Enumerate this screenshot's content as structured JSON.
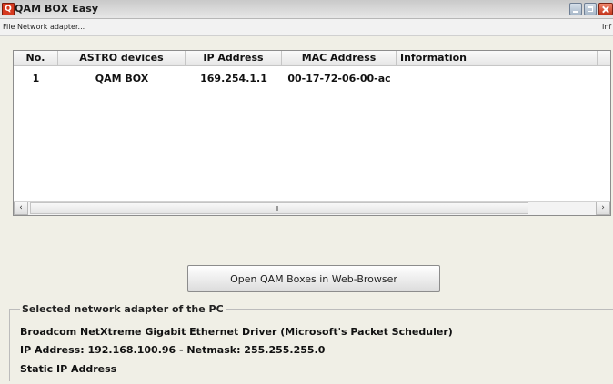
{
  "window": {
    "title": "QAM BOX Easy"
  },
  "menu": {
    "items": [
      "File",
      "Network adapter...",
      "Inf"
    ]
  },
  "table": {
    "headers": [
      "No.",
      "ASTRO devices",
      "IP Address",
      "MAC Address",
      "Information"
    ],
    "rows": [
      {
        "no": "1",
        "device": "QAM BOX",
        "ip": "169.254.1.1",
        "mac": "00-17-72-06-00-ac",
        "info": ""
      }
    ]
  },
  "buttons": {
    "open_web": "Open QAM Boxes in Web-Browser"
  },
  "adapter": {
    "group_title": "Selected network adapter of the PC",
    "driver": "Broadcom NetXtreme Gigabit Ethernet Driver (Microsoft's Packet Scheduler)",
    "address_line": "IP Address: 192.168.100.96  -  Netmask: 255.255.255.0",
    "mode": "Static IP Address"
  },
  "icons": {
    "app": "app-icon",
    "minimize": "minimize-icon",
    "maximize": "maximize-icon",
    "close": "close-icon",
    "scroll_left": "arrow-left-icon",
    "scroll_right": "arrow-right-icon"
  }
}
